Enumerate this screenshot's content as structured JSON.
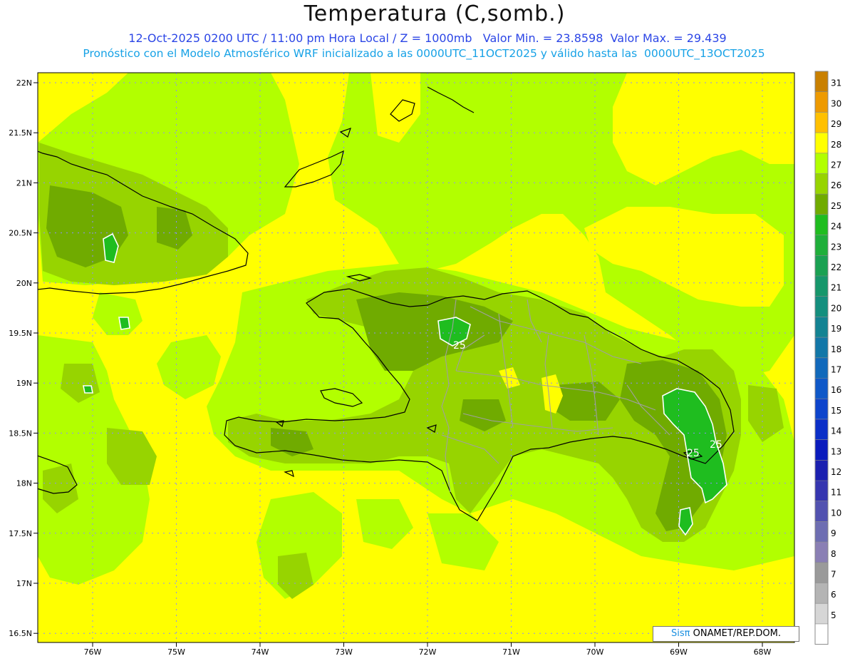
{
  "title": "Temperatura (C,somb.)",
  "subtitle_line1": "12-Oct-2025 0200 UTC / 11:00 pm Hora Local / Z = 1000mb   Valor Min. = 23.8598  Valor Max. = 29.439",
  "subtitle_line2": "Pronóstico con el Modelo Atmosférico WRF inicializado a las 0000UTC_11OCT2025 y válido hasta las  0000UTC_13OCT2025",
  "credit": {
    "brand": "Sisπ",
    "text": " ONAMET/REP.DOM."
  },
  "lat_labels": [
    "22N",
    "21.5N",
    "21N",
    "20.5N",
    "20N",
    "19.5N",
    "19N",
    "18.5N",
    "18N",
    "17.5N",
    "17N",
    "16.5N"
  ],
  "lon_labels": [
    "76W",
    "75W",
    "74W",
    "73W",
    "72W",
    "71W",
    "70W",
    "69W",
    "68W"
  ],
  "contour_labels": [
    "25",
    "25",
    "25"
  ],
  "colorbar": {
    "labels": [
      "31",
      "30",
      "29",
      "28",
      "27",
      "26",
      "25",
      "24",
      "23",
      "22",
      "21",
      "20",
      "19",
      "18",
      "17",
      "16",
      "15",
      "14",
      "13",
      "12",
      "11",
      "10",
      "9",
      "8",
      "7",
      "6",
      "5"
    ],
    "colors": [
      "#c98000",
      "#ee9a00",
      "#ffc000",
      "#ffff00",
      "#b2ff00",
      "#97d400",
      "#70ab00",
      "#1fbd1f",
      "#1faf3a",
      "#1aa152",
      "#16976b",
      "#148f7e",
      "#138393",
      "#1277a8",
      "#1169bb",
      "#0f58c8",
      "#0d44cc",
      "#0b2fc8",
      "#0a1bbd",
      "#1b20b0",
      "#3636b0",
      "#5252b0",
      "#6e6eb2",
      "#8a7fb4",
      "#9a9a9a",
      "#b4b4b4",
      "#d6d6d6",
      "#ffffff"
    ]
  },
  "map_colors": {
    "lvl28": "#ffff00",
    "lvl27": "#b2ff00",
    "lvl26": "#97d400",
    "lvl25": "#70ab00",
    "lvl24": "#1fbd1f",
    "grid": "#8c8cff",
    "coast": "#000000",
    "province": "#a0a0a0"
  }
}
